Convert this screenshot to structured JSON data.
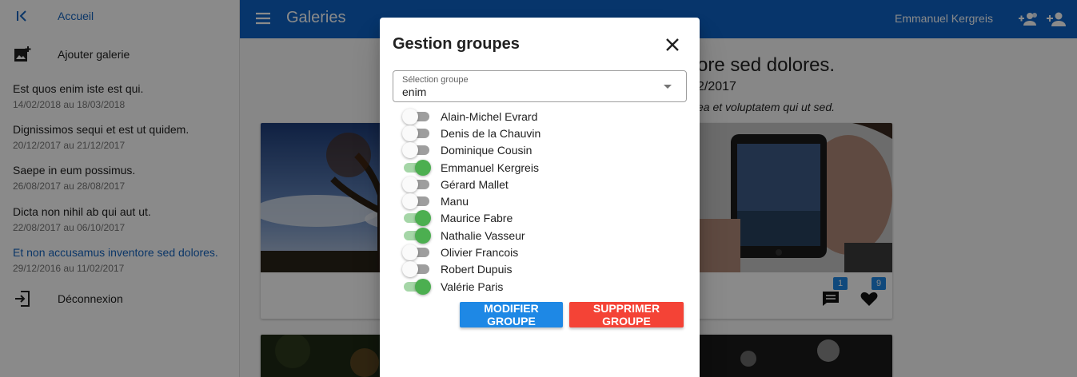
{
  "sidebar": {
    "home_label": "Accueil",
    "add_gallery_label": "Ajouter galerie",
    "galleries": [
      {
        "title": "Est quos enim iste est qui.",
        "dates": "14/02/2018 au 18/03/2018",
        "active": false
      },
      {
        "title": "Dignissimos sequi et est ut quidem.",
        "dates": "20/12/2017 au 21/12/2017",
        "active": false
      },
      {
        "title": "Saepe in eum possimus.",
        "dates": "26/08/2017 au 28/08/2017",
        "active": false
      },
      {
        "title": "Dicta non nihil ab qui aut ut.",
        "dates": "22/08/2017 au 06/10/2017",
        "active": false
      },
      {
        "title": "Et non accusamus inventore sed dolores.",
        "dates": "29/12/2016 au 11/02/2017",
        "active": true
      }
    ],
    "logout_label": "Déconnexion"
  },
  "appbar": {
    "title": "Galeries",
    "user_name": "Emmanuel Kergreis"
  },
  "main": {
    "title_fragment": "ore sed dolores.",
    "dates_fragment": "2/2017",
    "description_fragment": "ea et voluptatem qui ut sed.",
    "comments_count": "1",
    "likes_count": "9"
  },
  "dialog": {
    "title": "Gestion groupes",
    "select_label": "Sélection groupe",
    "select_value": "enim",
    "members": [
      {
        "name": "Alain-Michel Evrard",
        "on": false
      },
      {
        "name": "Denis de la Chauvin",
        "on": false
      },
      {
        "name": "Dominique Cousin",
        "on": false
      },
      {
        "name": "Emmanuel Kergreis",
        "on": true
      },
      {
        "name": "Gérard Mallet",
        "on": false
      },
      {
        "name": "Manu",
        "on": false
      },
      {
        "name": "Maurice Fabre",
        "on": true
      },
      {
        "name": "Nathalie Vasseur",
        "on": true
      },
      {
        "name": "Olivier Francois",
        "on": false
      },
      {
        "name": "Robert Dupuis",
        "on": false
      },
      {
        "name": "Valérie Paris",
        "on": true
      }
    ],
    "modify_label": "Modifier groupe",
    "delete_label": "Supprimer groupe"
  },
  "colors": {
    "primary": "#0d63c6",
    "accent_blue": "#1e88e5",
    "danger": "#f44336",
    "switch_on": "#4caf50"
  }
}
